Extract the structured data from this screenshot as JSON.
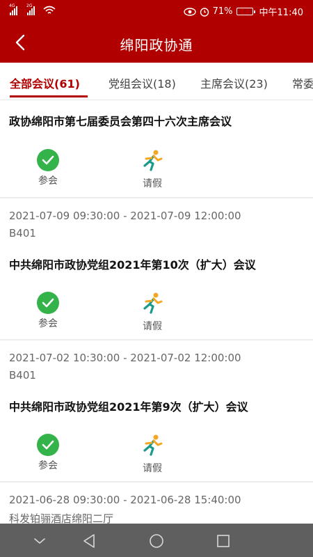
{
  "status_bar": {
    "network_1": "4G",
    "network_2": "2G",
    "battery": "71%",
    "time": "中午11:40"
  },
  "app_bar": {
    "title": "绵阳政协通",
    "back_icon": "chevron-left-icon"
  },
  "tabs": [
    {
      "label": "全部会议(61)",
      "active": true
    },
    {
      "label": "党组会议(18)",
      "active": false
    },
    {
      "label": "主席会议(23)",
      "active": false
    },
    {
      "label": "常委",
      "active": false
    }
  ],
  "accent_color": "#b00000",
  "meetings": [
    {
      "time_range": "",
      "location": "",
      "title": "政协绵阳市第七届委员会第四十六次主席会议",
      "attend_label": "参会",
      "leave_label": "请假"
    },
    {
      "time_range": "2021-07-09 09:30:00  -  2021-07-09 12:00:00",
      "location": "B401",
      "title": "中共绵阳市政协党组2021年第10次（扩大）会议",
      "attend_label": "参会",
      "leave_label": "请假"
    },
    {
      "time_range": "2021-07-02 10:30:00  -  2021-07-02 12:00:00",
      "location": "B401",
      "title": "中共绵阳市政协党组2021年第9次（扩大）会议",
      "attend_label": "参会",
      "leave_label": "请假"
    },
    {
      "time_range": "2021-06-28 09:30:00  -  2021-06-28 15:40:00",
      "location": "科发铂骊酒店绵阳二厅",
      "title": "",
      "attend_label": "",
      "leave_label": ""
    }
  ],
  "nav_bar": {
    "icons": [
      "chevron-down-icon",
      "back-triangle-icon",
      "home-circle-icon",
      "recents-square-icon"
    ]
  }
}
